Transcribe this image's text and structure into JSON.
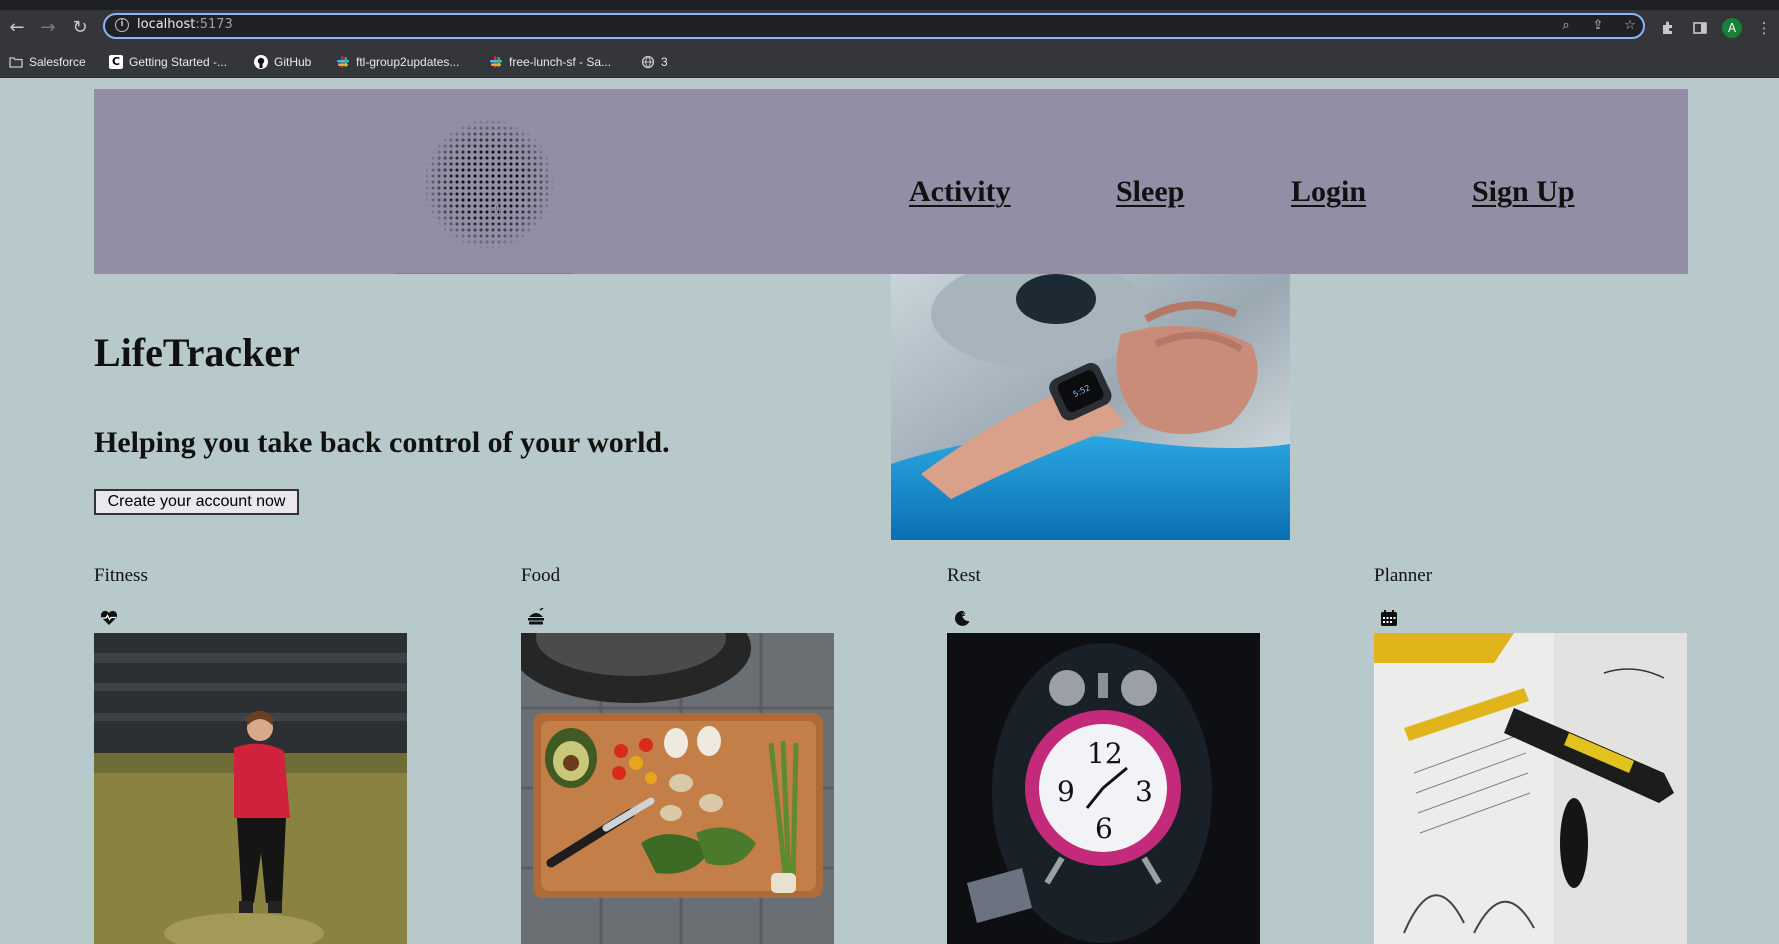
{
  "browser": {
    "url_host": "localhost",
    "url_port": ":5173",
    "profile_initial": "A",
    "bookmarks": [
      {
        "label": "Salesforce",
        "icon": "folder-icon"
      },
      {
        "label": "Getting Started -...",
        "icon": "c-logo-icon"
      },
      {
        "label": "GitHub",
        "icon": "github-icon"
      },
      {
        "label": "ftl-group2updates...",
        "icon": "slack-icon"
      },
      {
        "label": "free-lunch-sf - Sa...",
        "icon": "slack-icon"
      },
      {
        "label": "3",
        "icon": "globe-icon"
      }
    ]
  },
  "header": {
    "nav": [
      {
        "label": "Activity"
      },
      {
        "label": "Sleep"
      },
      {
        "label": "Login"
      },
      {
        "label": "Sign Up"
      }
    ]
  },
  "hero": {
    "title": "LifeTracker",
    "tagline": "Helping you take back control of your world.",
    "cta_label": "Create your account now",
    "image": "smartwatch-wrist-photo"
  },
  "tiles": [
    {
      "label": "Fitness",
      "icon": "heart-pulse-icon",
      "image": "woman-running-photo"
    },
    {
      "label": "Food",
      "icon": "burger-icon",
      "image": "vegetables-cutting-board-photo"
    },
    {
      "label": "Rest",
      "icon": "moon-sleep-icon",
      "image": "alarm-clock-photo"
    },
    {
      "label": "Planner",
      "icon": "calendar-icon",
      "image": "planner-notebook-photo"
    }
  ],
  "colors": {
    "page_bg": "#b8c9cc",
    "header_bg": "#938ea6",
    "browser_chrome": "#35363a",
    "omnibox_focus": "#8ab4f8"
  }
}
